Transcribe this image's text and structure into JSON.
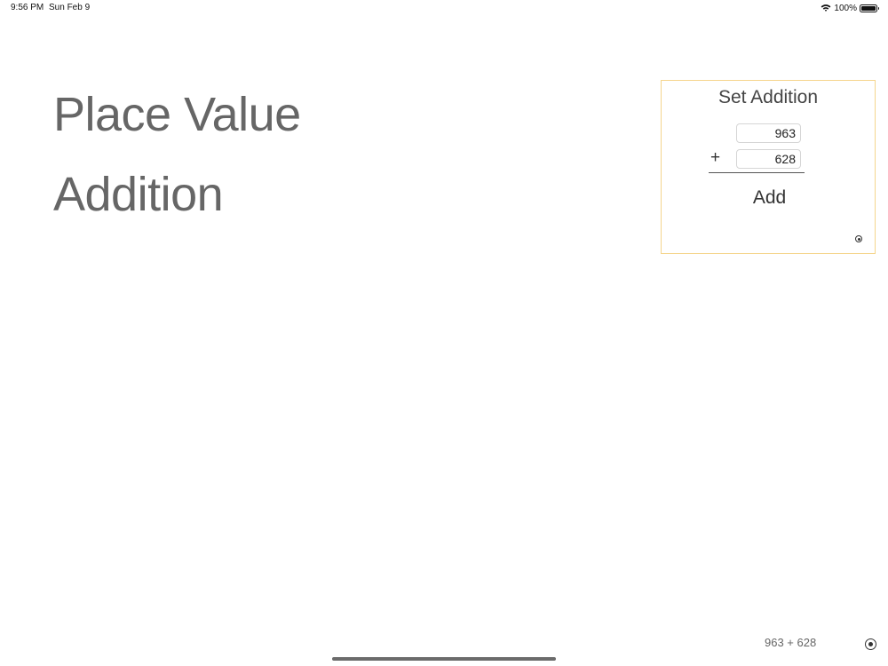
{
  "status_bar": {
    "time": "9:56 PM",
    "date": "Sun Feb 9",
    "battery_percent": "100%",
    "battery_level": 1.0,
    "icons": [
      "wifi-icon",
      "battery-icon"
    ]
  },
  "main": {
    "title_line_1": "Place Value",
    "title_line_2": "Addition"
  },
  "set_addition_panel": {
    "title": "Set Addition",
    "first_number": "963",
    "operator": "+",
    "second_number": "628",
    "add_label": "Add",
    "border_color": "#f5d58c"
  },
  "footer": {
    "equation": "963 + 628"
  }
}
